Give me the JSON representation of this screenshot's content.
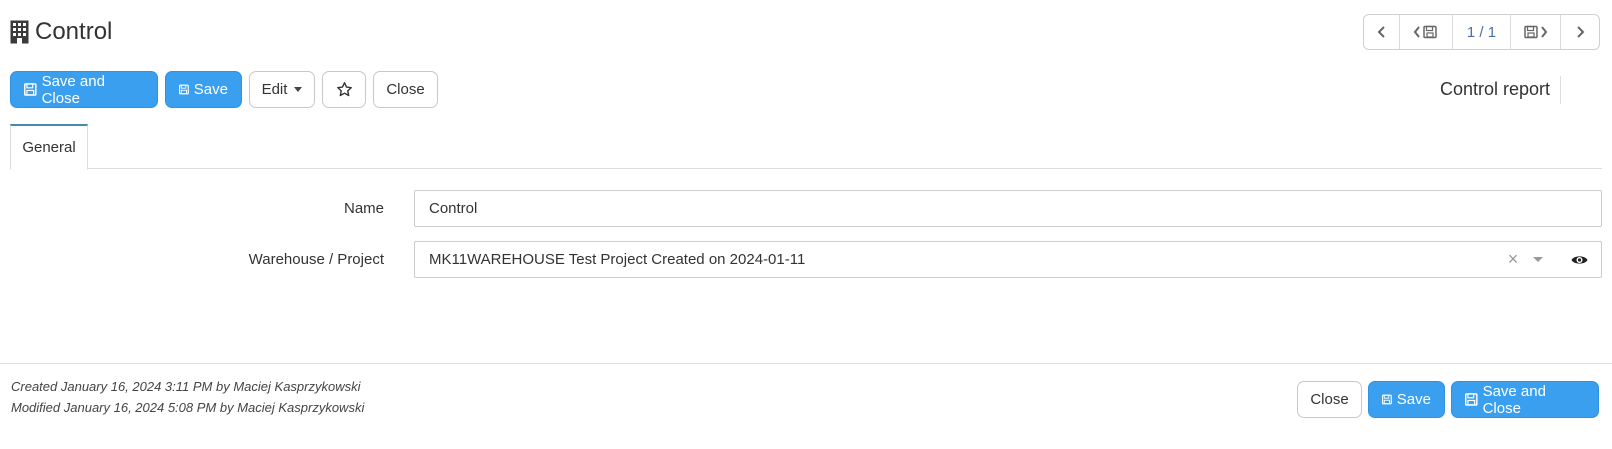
{
  "header": {
    "title": "Control",
    "icon": "building-icon"
  },
  "pager": {
    "prev_icon": "chevron-left-icon",
    "prev_record_icon": "chevron-left-save-icon",
    "count": "1 / 1",
    "next_record_icon": "save-chevron-right-icon",
    "next_icon": "chevron-right-icon"
  },
  "toolbar": {
    "save_close_label": "Save and Close",
    "save_label": "Save",
    "edit_label": "Edit",
    "favorite_icon": "star-icon",
    "close_label": "Close"
  },
  "report_link": "Control report",
  "tabs": [
    {
      "label": "General",
      "active": true
    }
  ],
  "form": {
    "name_label": "Name",
    "name_value": "Control",
    "warehouse_label": "Warehouse / Project",
    "warehouse_value": "MK11WAREHOUSE Test Project Created on 2024-01-11",
    "clear_glyph": "×"
  },
  "footer": {
    "created": "Created January 16, 2024 3:11 PM by Maciej Kasprzykowski",
    "modified": "Modified January 16, 2024 5:08 PM by Maciej Kasprzykowski",
    "close_label": "Close",
    "save_label": "Save",
    "save_close_label": "Save and Close"
  },
  "colors": {
    "primary": "#3b9ff0",
    "tab_accent": "#4a8ab0",
    "pager_count": "#4a6fa5"
  }
}
